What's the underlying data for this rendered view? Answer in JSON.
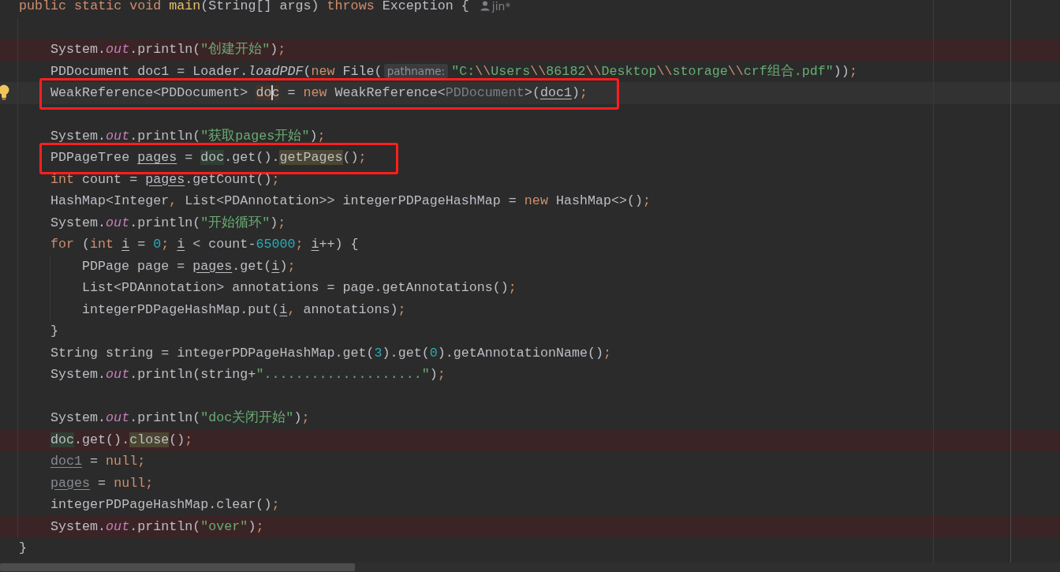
{
  "editor": {
    "header": [
      {
        "text": "public static void ",
        "kind": "kw"
      },
      {
        "text": "main",
        "kind": "decl"
      },
      {
        "text": "(String[] args) ",
        "kind": "plain"
      },
      {
        "text": "throws",
        "kind": "kw"
      },
      {
        "text": " Exception {",
        "kind": "plain"
      }
    ],
    "author": "jin*",
    "body": [
      {
        "kind": "blank"
      },
      {
        "kind": "breakpoint",
        "boxed": false,
        "bulb": false,
        "tokens": [
          {
            "text": "System.",
            "kind": "plain"
          },
          {
            "text": "out",
            "kind": "field"
          },
          {
            "text": ".println(",
            "kind": "plain"
          },
          {
            "text": "\"创建开始\"",
            "kind": "str"
          },
          {
            "text": ")",
            "kind": "plain"
          },
          {
            "text": ";",
            "kind": "punct"
          }
        ]
      },
      {
        "kind": "plain",
        "boxed": false,
        "bulb": false,
        "tokens": [
          {
            "text": "PDDocument doc1 = Loader.",
            "kind": "plain"
          },
          {
            "text": "loadPDF",
            "kind": "static"
          },
          {
            "text": "(",
            "kind": "plain"
          },
          {
            "text": "new",
            "kind": "kw"
          },
          {
            "text": " File(",
            "kind": "plain"
          },
          {
            "text": "pathname:",
            "kind": "hint"
          },
          {
            "text": "\"C:",
            "kind": "str"
          },
          {
            "text": "\\\\",
            "kind": "esc"
          },
          {
            "text": "Users",
            "kind": "str"
          },
          {
            "text": "\\\\",
            "kind": "esc"
          },
          {
            "text": "86182",
            "kind": "str"
          },
          {
            "text": "\\\\",
            "kind": "esc"
          },
          {
            "text": "Desktop",
            "kind": "str"
          },
          {
            "text": "\\\\",
            "kind": "esc"
          },
          {
            "text": "storage",
            "kind": "str"
          },
          {
            "text": "\\\\",
            "kind": "esc"
          },
          {
            "text": "crf组合.pdf\"",
            "kind": "str"
          },
          {
            "text": "))",
            "kind": "plain"
          },
          {
            "text": ";",
            "kind": "punct"
          }
        ]
      },
      {
        "kind": "caret",
        "boxed": true,
        "bulb": true,
        "tokens": [
          {
            "text": "WeakReference<PDDocument> ",
            "kind": "plain"
          },
          {
            "text": "do",
            "kind": "write-usage"
          },
          {
            "text": "c",
            "kind": "write-usage",
            "caret": true
          },
          {
            "text": " = ",
            "kind": "plain"
          },
          {
            "text": "new",
            "kind": "kw"
          },
          {
            "text": " WeakReference<",
            "kind": "plain"
          },
          {
            "text": "PDDocument",
            "kind": "generic"
          },
          {
            "text": ">(",
            "kind": "plain"
          },
          {
            "text": "doc1",
            "kind": "reassigned"
          },
          {
            "text": ")",
            "kind": "plain"
          },
          {
            "text": ";",
            "kind": "punct"
          }
        ]
      },
      {
        "kind": "blank"
      },
      {
        "kind": "plain",
        "boxed": false,
        "bulb": false,
        "tokens": [
          {
            "text": "System.",
            "kind": "plain"
          },
          {
            "text": "out",
            "kind": "field"
          },
          {
            "text": ".println(",
            "kind": "plain"
          },
          {
            "text": "\"获取pages开始\"",
            "kind": "str"
          },
          {
            "text": ")",
            "kind": "plain"
          },
          {
            "text": ";",
            "kind": "punct"
          }
        ]
      },
      {
        "kind": "plain",
        "boxed": true,
        "bulb": false,
        "tokens": [
          {
            "text": "PDPageTree ",
            "kind": "plain"
          },
          {
            "text": "pages",
            "kind": "reassigned"
          },
          {
            "text": " = ",
            "kind": "plain"
          },
          {
            "text": "doc",
            "kind": "read-usage"
          },
          {
            "text": ".get().",
            "kind": "plain"
          },
          {
            "text": "getPages",
            "kind": "call-usage"
          },
          {
            "text": "()",
            "kind": "plain"
          },
          {
            "text": ";",
            "kind": "punct"
          }
        ]
      },
      {
        "kind": "plain",
        "boxed": false,
        "bulb": false,
        "tokens": [
          {
            "text": "int",
            "kind": "kw"
          },
          {
            "text": " count = ",
            "kind": "plain"
          },
          {
            "text": "pages",
            "kind": "reassigned"
          },
          {
            "text": ".getCount()",
            "kind": "plain"
          },
          {
            "text": ";",
            "kind": "punct"
          }
        ]
      },
      {
        "kind": "plain",
        "boxed": false,
        "bulb": false,
        "tokens": [
          {
            "text": "HashMap<Integer",
            "kind": "plain"
          },
          {
            "text": ",",
            "kind": "punct"
          },
          {
            "text": " List<PDAnnotation>> integerPDPageHashMap = ",
            "kind": "plain"
          },
          {
            "text": "new",
            "kind": "kw"
          },
          {
            "text": " HashMap<>()",
            "kind": "plain"
          },
          {
            "text": ";",
            "kind": "punct"
          }
        ]
      },
      {
        "kind": "plain",
        "boxed": false,
        "bulb": false,
        "tokens": [
          {
            "text": "System.",
            "kind": "plain"
          },
          {
            "text": "out",
            "kind": "field"
          },
          {
            "text": ".println(",
            "kind": "plain"
          },
          {
            "text": "\"开始循环\"",
            "kind": "str"
          },
          {
            "text": ")",
            "kind": "plain"
          },
          {
            "text": ";",
            "kind": "punct"
          }
        ]
      },
      {
        "kind": "plain",
        "boxed": false,
        "bulb": false,
        "tokens": [
          {
            "text": "for",
            "kind": "kw"
          },
          {
            "text": " (",
            "kind": "plain"
          },
          {
            "text": "int ",
            "kind": "kw"
          },
          {
            "text": "i",
            "kind": "reassigned"
          },
          {
            "text": " = ",
            "kind": "plain"
          },
          {
            "text": "0",
            "kind": "num"
          },
          {
            "text": "; ",
            "kind": "punct"
          },
          {
            "text": "i",
            "kind": "reassigned"
          },
          {
            "text": " < count-",
            "kind": "plain"
          },
          {
            "text": "65000",
            "kind": "num"
          },
          {
            "text": "; ",
            "kind": "punct"
          },
          {
            "text": "i",
            "kind": "reassigned"
          },
          {
            "text": "++) {",
            "kind": "plain"
          }
        ],
        "children": [
          {
            "kind": "plain",
            "boxed": false,
            "bulb": false,
            "tokens": [
              {
                "text": "PDPage page = ",
                "kind": "plain"
              },
              {
                "text": "pages",
                "kind": "reassigned"
              },
              {
                "text": ".get(",
                "kind": "plain"
              },
              {
                "text": "i",
                "kind": "reassigned"
              },
              {
                "text": ")",
                "kind": "plain"
              },
              {
                "text": ";",
                "kind": "punct"
              }
            ]
          },
          {
            "kind": "plain",
            "boxed": false,
            "bulb": false,
            "tokens": [
              {
                "text": "List<PDAnnotation> annotations = page.getAnnotations()",
                "kind": "plain"
              },
              {
                "text": ";",
                "kind": "punct"
              }
            ]
          },
          {
            "kind": "plain",
            "boxed": false,
            "bulb": false,
            "tokens": [
              {
                "text": "integerPDPageHashMap.put(",
                "kind": "plain"
              },
              {
                "text": "i",
                "kind": "reassigned"
              },
              {
                "text": ",",
                "kind": "punct"
              },
              {
                "text": " annotations)",
                "kind": "plain"
              },
              {
                "text": ";",
                "kind": "punct"
              }
            ]
          }
        ],
        "closing": [
          {
            "text": "}",
            "kind": "plain"
          }
        ]
      },
      {
        "kind": "plain",
        "boxed": false,
        "bulb": false,
        "tokens": [
          {
            "text": "String string = integerPDPageHashMap.get(",
            "kind": "plain"
          },
          {
            "text": "3",
            "kind": "num"
          },
          {
            "text": ").get(",
            "kind": "plain"
          },
          {
            "text": "0",
            "kind": "num"
          },
          {
            "text": ").getAnnotationName()",
            "kind": "plain"
          },
          {
            "text": ";",
            "kind": "punct"
          }
        ]
      },
      {
        "kind": "plain",
        "boxed": false,
        "bulb": false,
        "tokens": [
          {
            "text": "System.",
            "kind": "plain"
          },
          {
            "text": "out",
            "kind": "field"
          },
          {
            "text": ".println(string+",
            "kind": "plain"
          },
          {
            "text": "\"....................\"",
            "kind": "str"
          },
          {
            "text": ")",
            "kind": "plain"
          },
          {
            "text": ";",
            "kind": "punct"
          }
        ]
      },
      {
        "kind": "blank"
      },
      {
        "kind": "plain",
        "boxed": false,
        "bulb": false,
        "tokens": [
          {
            "text": "System.",
            "kind": "plain"
          },
          {
            "text": "out",
            "kind": "field"
          },
          {
            "text": ".println(",
            "kind": "plain"
          },
          {
            "text": "\"doc关闭开始\"",
            "kind": "str"
          },
          {
            "text": ")",
            "kind": "plain"
          },
          {
            "text": ";",
            "kind": "punct"
          }
        ]
      },
      {
        "kind": "breakpoint",
        "boxed": false,
        "bulb": false,
        "tokens": [
          {
            "text": "doc",
            "kind": "read-usage"
          },
          {
            "text": ".get().",
            "kind": "plain"
          },
          {
            "text": "close",
            "kind": "call-usage"
          },
          {
            "text": "()",
            "kind": "plain"
          },
          {
            "text": ";",
            "kind": "punct"
          }
        ]
      },
      {
        "kind": "plain",
        "boxed": false,
        "bulb": false,
        "tokens": [
          {
            "text": "doc1",
            "kind": "unused"
          },
          {
            "text": " = ",
            "kind": "plain"
          },
          {
            "text": "null",
            "kind": "kw"
          },
          {
            "text": ";",
            "kind": "punct"
          }
        ]
      },
      {
        "kind": "plain",
        "boxed": false,
        "bulb": false,
        "tokens": [
          {
            "text": "pages",
            "kind": "unused"
          },
          {
            "text": " = ",
            "kind": "plain"
          },
          {
            "text": "null",
            "kind": "kw"
          },
          {
            "text": ";",
            "kind": "punct"
          }
        ]
      },
      {
        "kind": "plain",
        "boxed": false,
        "bulb": false,
        "tokens": [
          {
            "text": "integerPDPageHashMap.clear()",
            "kind": "plain"
          },
          {
            "text": ";",
            "kind": "punct"
          }
        ]
      },
      {
        "kind": "breakpoint",
        "boxed": false,
        "bulb": false,
        "tokens": [
          {
            "text": "System.",
            "kind": "plain"
          },
          {
            "text": "out",
            "kind": "field"
          },
          {
            "text": ".println(",
            "kind": "plain"
          },
          {
            "text": "\"over\"",
            "kind": "str"
          },
          {
            "text": ")",
            "kind": "plain"
          },
          {
            "text": ";",
            "kind": "punct"
          }
        ]
      }
    ],
    "footer": [
      {
        "text": "}",
        "kind": "plain"
      }
    ]
  }
}
